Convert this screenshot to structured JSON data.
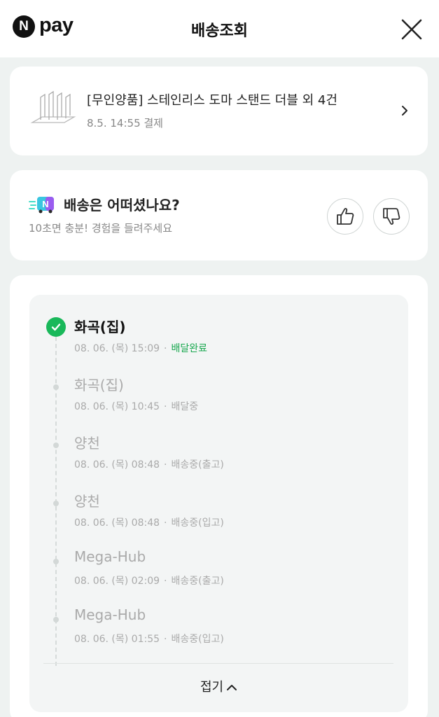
{
  "header": {
    "logo_letter": "N",
    "logo_text": "pay",
    "title": "배송조회"
  },
  "product": {
    "name": "[무인양품] 스테인리스 도마 스탠드 더블 외 4건",
    "meta": "8.5. 14:55 결제"
  },
  "feedback": {
    "icon_letter": "N",
    "title": "배송은 어떠셨나요?",
    "subtitle": "10초면 충분! 경험을 들려주세요"
  },
  "timeline": {
    "items": [
      {
        "place": "화곡(집)",
        "time": "08. 06. (목) 15:09",
        "status": "배달완료",
        "done": true
      },
      {
        "place": "화곡(집)",
        "time": "08. 06. (목) 10:45",
        "status": "배달중",
        "done": false
      },
      {
        "place": "양천",
        "time": "08. 06. (목) 08:48",
        "status": "배송중(출고)",
        "done": false
      },
      {
        "place": "양천",
        "time": "08. 06. (목) 08:48",
        "status": "배송중(입고)",
        "done": false
      },
      {
        "place": "Mega-Hub",
        "time": "08. 06. (목) 02:09",
        "status": "배송중(출고)",
        "done": false
      },
      {
        "place": "Mega-Hub",
        "time": "08. 06. (목) 01:55",
        "status": "배송중(입고)",
        "done": false
      }
    ],
    "separator": "·",
    "collapse_label": "접기"
  },
  "colors": {
    "accent_green": "#19b85a",
    "background": "#eef2f1"
  }
}
